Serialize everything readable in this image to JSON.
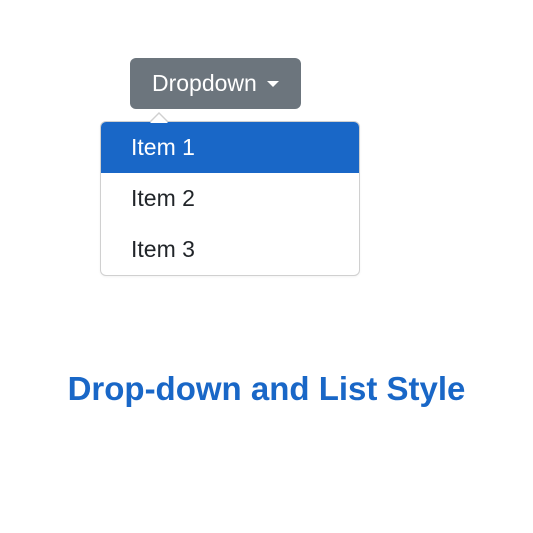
{
  "dropdown": {
    "button_label": "Dropdown",
    "items": [
      {
        "label": "Item 1",
        "active": true
      },
      {
        "label": "Item 2",
        "active": false
      },
      {
        "label": "Item 3",
        "active": false
      }
    ]
  },
  "caption": "Drop-down and List Style",
  "colors": {
    "button_bg": "#6c757d",
    "active_bg": "#1967c7",
    "caption_color": "#1967c7"
  }
}
